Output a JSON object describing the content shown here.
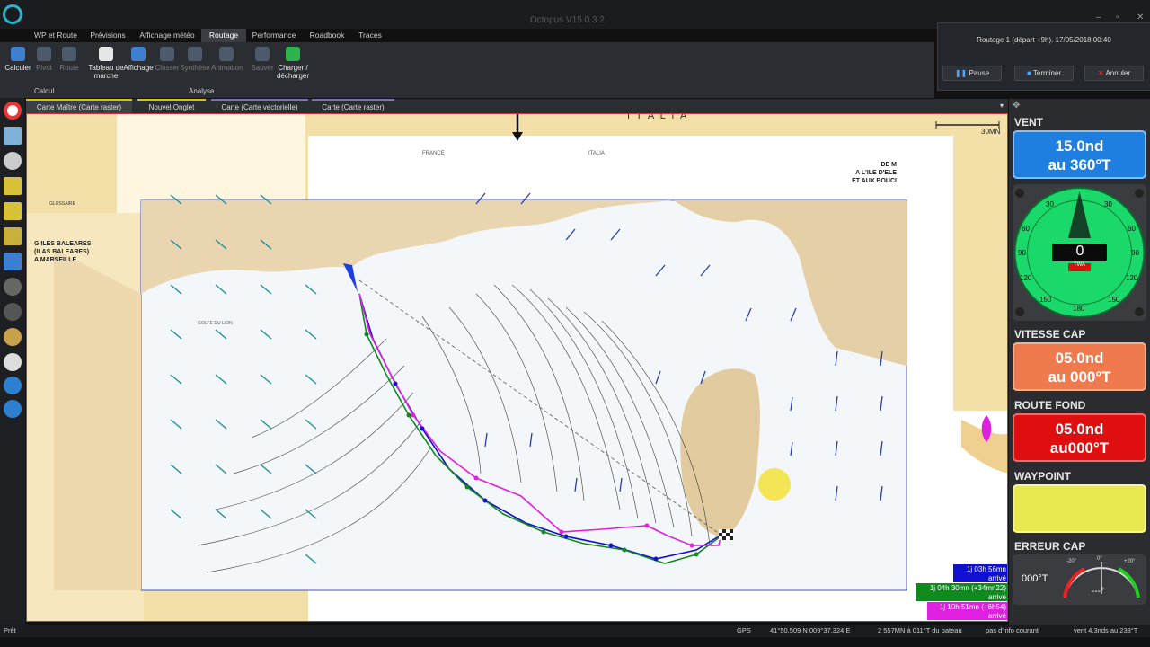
{
  "app": {
    "title": "Octopus V15.0.3.2"
  },
  "menu": {
    "tabs": [
      "WP et Route",
      "Prévisions",
      "Affichage météo",
      "Routage",
      "Performance",
      "Roadbook",
      "Traces"
    ],
    "active": "Routage"
  },
  "ribbon": {
    "buttons": [
      "Calculer",
      "Pivot",
      "Route",
      "Tableau de marche",
      "Affichage",
      "Classer",
      "Synthèse",
      "Animation",
      "Sauver",
      "Charger / décharger"
    ],
    "groups": {
      "calc": "Calcul",
      "analyse": "Analyse"
    }
  },
  "routage": {
    "label": "Routage 1 (départ +9h). 17/05/2018 00:40",
    "pause": "Pause",
    "terminer": "Terminer",
    "annuler": "Annuler"
  },
  "chart_tabs": [
    "Carte Maître (Carte raster)",
    "Nouvel Onglet",
    "Carte (Carte vectorielle)",
    "Carte (Carte raster)"
  ],
  "map": {
    "scale_label": "30MN",
    "country_label": "I T A L I A",
    "chart_title_left": [
      "G ILES BALEARES",
      "(ILAS BALEARES)",
      "A MARSEILLE"
    ],
    "chart_title_right": [
      "DE M",
      "A L'ILE D'ELE",
      "ET AUX BOUCI"
    ],
    "glossary": "GLOSSAIRE",
    "place_labels": [
      "FRANCE",
      "ITALIA",
      "GOLFE DU LION"
    ]
  },
  "arrivals": [
    {
      "time": "1j 03h 56mn",
      "sub": "arrivé",
      "color": "#1010d0"
    },
    {
      "time": "1j 04h 30mn (+34mn22)",
      "sub": "arrivé",
      "color": "#0f8a1e"
    },
    {
      "time": "1j 10h 51mn (+6h54)",
      "sub": "arrivé",
      "color": "#e020e0"
    }
  ],
  "instruments": {
    "vent": {
      "title": "VENT",
      "line1": "15.0nd",
      "line2": "au 360°T",
      "color": "#1e7fe0"
    },
    "gauge": {
      "display": "0",
      "label": "TWA",
      "ticks": [
        "30",
        "30",
        "60",
        "60",
        "90",
        "90",
        "120",
        "120",
        "150",
        "150",
        "180"
      ]
    },
    "vitesse": {
      "title": "VITESSE CAP",
      "line1": "05.0nd",
      "line2": "au 000°T",
      "color": "#ee7a4e"
    },
    "route": {
      "title": "ROUTE FOND",
      "line1": "05.0nd",
      "line2": "au000°T",
      "color": "#e00f0f"
    },
    "waypoint": {
      "title": "WAYPOINT",
      "line1": "",
      "color": "#e8e850"
    },
    "erreur": {
      "title": "ERREUR CAP",
      "value": "000°T",
      "scale_left": "-20°",
      "scale_mid": "0°",
      "scale_right": "+20°",
      "display": "---°"
    }
  },
  "status": {
    "ready": "Prêt",
    "gps": "GPS",
    "position": "41°50.509 N 009°37.324 E",
    "distance": "2 557MN à 011°T du bateau",
    "info": "pas d'info courant",
    "wind": "vent 4.3nds au 233°T"
  }
}
